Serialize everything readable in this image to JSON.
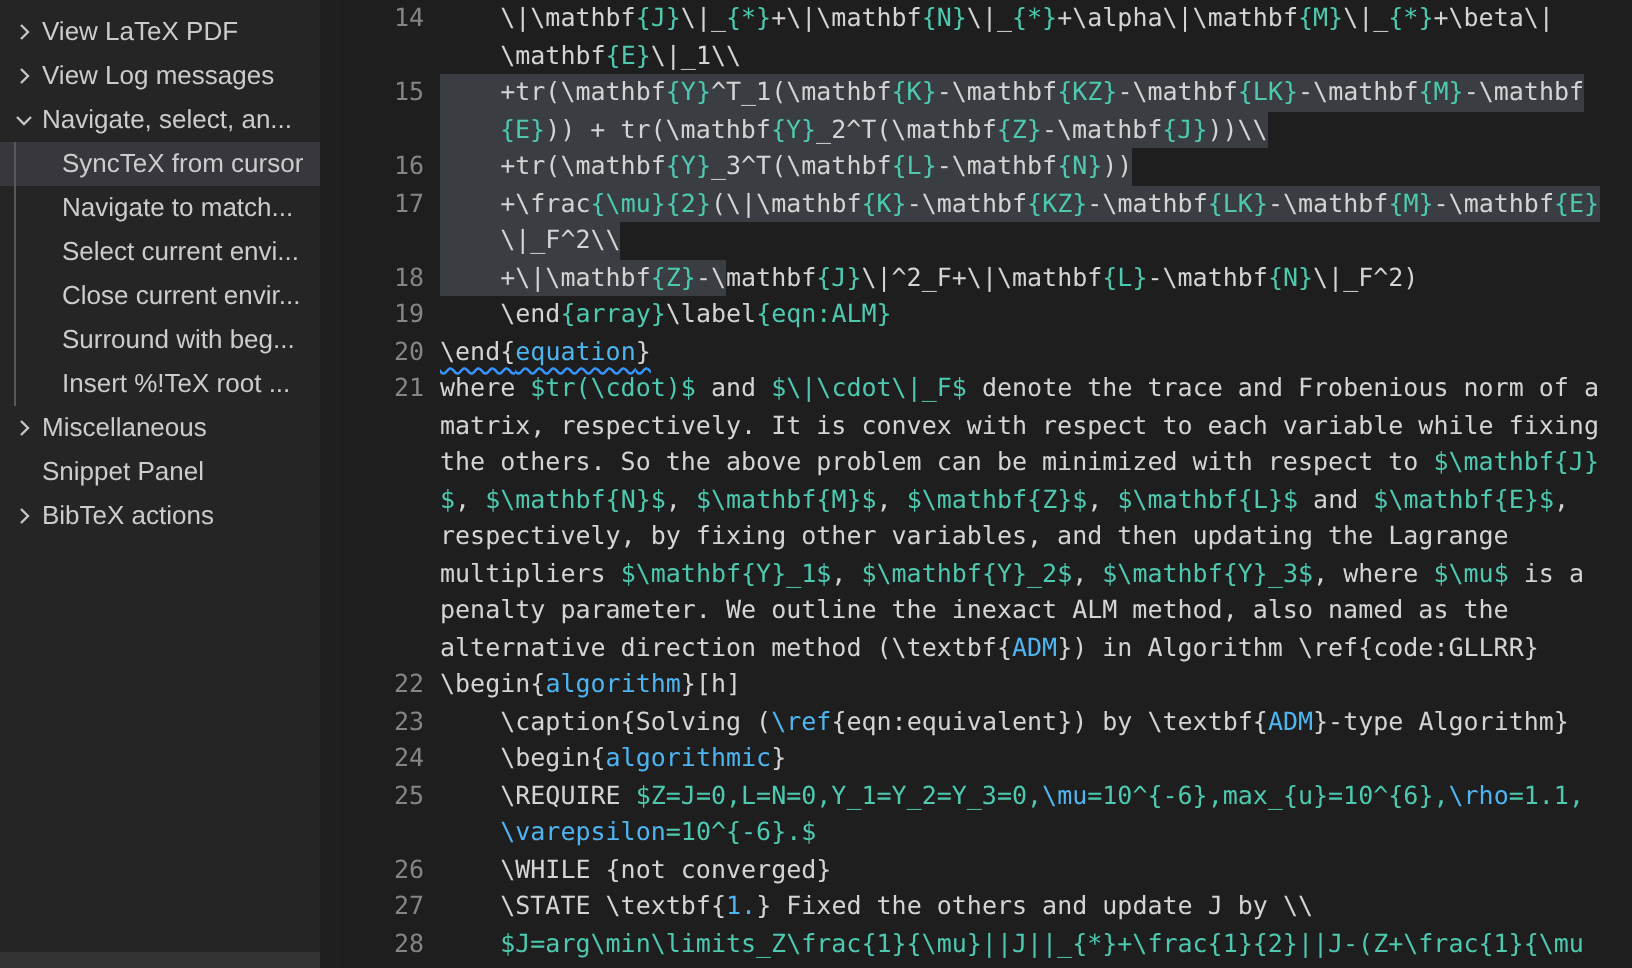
{
  "sidebar": {
    "items": [
      {
        "label": "View LaTeX PDF",
        "expanded": false,
        "selected": false
      },
      {
        "label": "View Log messages",
        "expanded": false,
        "selected": false
      },
      {
        "label": "Navigate, select, an...",
        "expanded": true,
        "selected": false,
        "children": [
          {
            "label": "SyncTeX from cursor",
            "selected": true
          },
          {
            "label": "Navigate to match...",
            "selected": false
          },
          {
            "label": "Select current envi...",
            "selected": false
          },
          {
            "label": "Close current envir...",
            "selected": false
          },
          {
            "label": "Surround with beg...",
            "selected": false
          },
          {
            "label": "Insert %!TeX root ...",
            "selected": false
          }
        ]
      },
      {
        "label": "Miscellaneous",
        "expanded": false,
        "selected": false
      },
      {
        "label": "Snippet Panel",
        "selected": false
      },
      {
        "label": "BibTeX actions",
        "expanded": false,
        "selected": false
      }
    ]
  },
  "editor": {
    "rows": [
      {
        "num": "14",
        "tokens": [
          {
            "kind": "plain",
            "text": "    \\|\\mathbf"
          },
          {
            "kind": "math",
            "text": "{J}"
          },
          {
            "kind": "plain",
            "text": "\\|_"
          },
          {
            "kind": "math",
            "text": "{*}"
          },
          {
            "kind": "plain",
            "text": "+\\|\\mathbf"
          },
          {
            "kind": "math",
            "text": "{N}"
          },
          {
            "kind": "plain",
            "text": "\\|_"
          },
          {
            "kind": "math",
            "text": "{*}"
          },
          {
            "kind": "plain",
            "text": "+\\alpha\\|\\mathbf"
          },
          {
            "kind": "math",
            "text": "{M}"
          },
          {
            "kind": "plain",
            "text": "\\|_"
          },
          {
            "kind": "math",
            "text": "{*}"
          },
          {
            "kind": "plain",
            "text": "+\\beta\\|"
          }
        ]
      },
      {
        "tokens": [
          {
            "kind": "plain",
            "text": "    \\mathbf"
          },
          {
            "kind": "math",
            "text": "{E}"
          },
          {
            "kind": "plain",
            "text": "\\|_1\\\\"
          }
        ]
      },
      {
        "num": "15",
        "tokens": [
          {
            "kind": "plain",
            "text": "    +tr(\\mathbf",
            "selected": true
          },
          {
            "kind": "math",
            "text": "{Y}",
            "selected": true
          },
          {
            "kind": "plain",
            "text": "^T_1(\\mathbf",
            "selected": true
          },
          {
            "kind": "math",
            "text": "{K}",
            "selected": true
          },
          {
            "kind": "plain",
            "text": "-\\mathbf",
            "selected": true
          },
          {
            "kind": "math",
            "text": "{KZ}",
            "selected": true
          },
          {
            "kind": "plain",
            "text": "-\\mathbf",
            "selected": true
          },
          {
            "kind": "math",
            "text": "{LK}",
            "selected": true
          },
          {
            "kind": "plain",
            "text": "-\\mathbf",
            "selected": true
          },
          {
            "kind": "math",
            "text": "{M}",
            "selected": true
          },
          {
            "kind": "plain",
            "text": "-\\mathbf",
            "selected": true
          }
        ]
      },
      {
        "indented": true,
        "tokens": [
          {
            "kind": "math",
            "text": "{E}",
            "selected": true
          },
          {
            "kind": "plain",
            "text": ")) + tr(\\mathbf",
            "selected": true
          },
          {
            "kind": "math",
            "text": "{Y}",
            "selected": true
          },
          {
            "kind": "plain",
            "text": "_2^T(\\mathbf",
            "selected": true
          },
          {
            "kind": "math",
            "text": "{Z}",
            "selected": true
          },
          {
            "kind": "plain",
            "text": "-\\mathbf",
            "selected": true
          },
          {
            "kind": "math",
            "text": "{J}",
            "selected": true
          },
          {
            "kind": "plain",
            "text": "))\\\\",
            "selected": true
          }
        ]
      },
      {
        "num": "16",
        "tokens": [
          {
            "kind": "plain",
            "text": "    +tr(\\mathbf",
            "selected": true
          },
          {
            "kind": "math",
            "text": "{Y}",
            "selected": true
          },
          {
            "kind": "plain",
            "text": "_3^T(\\mathbf",
            "selected": true
          },
          {
            "kind": "math",
            "text": "{L}",
            "selected": true
          },
          {
            "kind": "plain",
            "text": "-\\mathbf",
            "selected": true
          },
          {
            "kind": "math",
            "text": "{N}",
            "selected": true
          },
          {
            "kind": "plain",
            "text": "))",
            "selected": true
          }
        ]
      },
      {
        "num": "17",
        "tokens": [
          {
            "kind": "plain",
            "text": "    +\\frac",
            "selected": true
          },
          {
            "kind": "math",
            "text": "{\\mu}{2}",
            "selected": true
          },
          {
            "kind": "plain",
            "text": "(\\|\\mathbf",
            "selected": true
          },
          {
            "kind": "math",
            "text": "{K}",
            "selected": true
          },
          {
            "kind": "plain",
            "text": "-\\mathbf",
            "selected": true
          },
          {
            "kind": "math",
            "text": "{KZ}",
            "selected": true
          },
          {
            "kind": "plain",
            "text": "-\\mathbf",
            "selected": true
          },
          {
            "kind": "math",
            "text": "{LK}",
            "selected": true
          },
          {
            "kind": "plain",
            "text": "-\\mathbf",
            "selected": true
          },
          {
            "kind": "math",
            "text": "{M}",
            "selected": true
          },
          {
            "kind": "plain",
            "text": "-\\mathbf",
            "selected": true
          },
          {
            "kind": "math",
            "text": "{E}",
            "selected": true
          }
        ]
      },
      {
        "tokens": [
          {
            "kind": "plain",
            "text": "    \\|_F^2\\\\",
            "selected": true
          }
        ]
      },
      {
        "num": "18",
        "tokens": [
          {
            "kind": "plain",
            "text": "    +\\|\\mathbf",
            "selected": true
          },
          {
            "kind": "math",
            "text": "{Z}",
            "selected": true
          },
          {
            "kind": "plain",
            "text": "-\\",
            "selected": true
          },
          {
            "kind": "plain",
            "text": "mathbf",
            "selected": false
          },
          {
            "kind": "math",
            "text": "{J}"
          },
          {
            "kind": "plain",
            "text": "\\|^2_F+\\|\\mathbf"
          },
          {
            "kind": "math",
            "text": "{L}"
          },
          {
            "kind": "plain",
            "text": "-\\mathbf"
          },
          {
            "kind": "math",
            "text": "{N}"
          },
          {
            "kind": "plain",
            "text": "\\|_F^2)"
          }
        ]
      },
      {
        "num": "19",
        "tokens": [
          {
            "kind": "plain",
            "text": "    \\end"
          },
          {
            "kind": "math",
            "text": "{array}"
          },
          {
            "kind": "plain",
            "text": "\\label"
          },
          {
            "kind": "math",
            "text": "{eqn:ALM}"
          }
        ]
      },
      {
        "num": "20",
        "warning": true,
        "tokens": [
          {
            "kind": "plain",
            "text": "\\end{"
          },
          {
            "kind": "name",
            "text": "equation"
          },
          {
            "kind": "plain",
            "text": "}"
          }
        ]
      },
      {
        "num": "21",
        "tokens": [
          {
            "kind": "plain",
            "text": "where "
          },
          {
            "kind": "math",
            "text": "$tr(\\cdot)$"
          },
          {
            "kind": "plain",
            "text": " and "
          },
          {
            "kind": "math",
            "text": "$\\|\\cdot\\|_F$"
          },
          {
            "kind": "plain",
            "text": " denote the trace and Frobenious norm of a"
          }
        ]
      },
      {
        "tokens": [
          {
            "kind": "plain",
            "text": "matrix, respectively. It is convex with respect to each variable while fixing"
          }
        ]
      },
      {
        "tokens": [
          {
            "kind": "plain",
            "text": "the others. So the above problem can be minimized with respect to "
          },
          {
            "kind": "math",
            "text": "$\\mathbf{J}"
          }
        ]
      },
      {
        "tokens": [
          {
            "kind": "math",
            "text": "$"
          },
          {
            "kind": "plain",
            "text": ", "
          },
          {
            "kind": "math",
            "text": "$\\mathbf{N}$"
          },
          {
            "kind": "plain",
            "text": ", "
          },
          {
            "kind": "math",
            "text": "$\\mathbf{M}$"
          },
          {
            "kind": "plain",
            "text": ", "
          },
          {
            "kind": "math",
            "text": "$\\mathbf{Z}$"
          },
          {
            "kind": "plain",
            "text": ", "
          },
          {
            "kind": "math",
            "text": "$\\mathbf{L}$"
          },
          {
            "kind": "plain",
            "text": " and "
          },
          {
            "kind": "math",
            "text": "$\\mathbf{E}$"
          },
          {
            "kind": "plain",
            "text": ","
          }
        ]
      },
      {
        "tokens": [
          {
            "kind": "plain",
            "text": "respectively, by fixing other variables, and then updating the Lagrange"
          }
        ]
      },
      {
        "tokens": [
          {
            "kind": "plain",
            "text": "multipliers "
          },
          {
            "kind": "math",
            "text": "$\\mathbf{Y}_1$"
          },
          {
            "kind": "plain",
            "text": ", "
          },
          {
            "kind": "math",
            "text": "$\\mathbf{Y}_2$"
          },
          {
            "kind": "plain",
            "text": ", "
          },
          {
            "kind": "math",
            "text": "$\\mathbf{Y}_3$"
          },
          {
            "kind": "plain",
            "text": ", where "
          },
          {
            "kind": "math",
            "text": "$\\mu$"
          },
          {
            "kind": "plain",
            "text": " is a"
          }
        ]
      },
      {
        "tokens": [
          {
            "kind": "plain",
            "text": "penalty parameter. We outline the inexact ALM method, also named as the"
          }
        ]
      },
      {
        "tokens": [
          {
            "kind": "plain",
            "text": "alternative direction method (\\textbf{"
          },
          {
            "kind": "name",
            "text": "ADM"
          },
          {
            "kind": "plain",
            "text": "}) in Algorithm \\ref{code:GLLRR}"
          }
        ]
      },
      {
        "num": "22",
        "tokens": [
          {
            "kind": "plain",
            "text": "\\begin{"
          },
          {
            "kind": "name",
            "text": "algorithm"
          },
          {
            "kind": "plain",
            "text": "}[h]"
          }
        ]
      },
      {
        "num": "23",
        "tokens": [
          {
            "kind": "plain",
            "text": "    \\caption{Solving ("
          },
          {
            "kind": "name",
            "text": "\\ref"
          },
          {
            "kind": "plain",
            "text": "{eqn:equivalent}) by \\textbf{"
          },
          {
            "kind": "name",
            "text": "ADM"
          },
          {
            "kind": "plain",
            "text": "}-type Algorithm}"
          }
        ]
      },
      {
        "num": "24",
        "tokens": [
          {
            "kind": "plain",
            "text": "    \\begin{"
          },
          {
            "kind": "name",
            "text": "algorithmic"
          },
          {
            "kind": "plain",
            "text": "}"
          }
        ]
      },
      {
        "num": "25",
        "tokens": [
          {
            "kind": "plain",
            "text": "    \\REQUIRE "
          },
          {
            "kind": "math",
            "text": "$Z=J=0,L=N=0,Y_1=Y_2=Y_3=0,"
          },
          {
            "kind": "name",
            "text": "\\mu"
          },
          {
            "kind": "math",
            "text": "=10^{-6},max_{u}=10^{6},"
          },
          {
            "kind": "name",
            "text": "\\rho"
          },
          {
            "kind": "math",
            "text": "=1.1,"
          }
        ]
      },
      {
        "indented": true,
        "tokens": [
          {
            "kind": "name",
            "text": "\\varepsilon"
          },
          {
            "kind": "math",
            "text": "=10^{-6}.$"
          }
        ]
      },
      {
        "num": "26",
        "tokens": [
          {
            "kind": "plain",
            "text": "    \\WHILE {not converged}"
          }
        ]
      },
      {
        "num": "27",
        "tokens": [
          {
            "kind": "plain",
            "text": "    \\STATE \\textbf{"
          },
          {
            "kind": "name",
            "text": "1."
          },
          {
            "kind": "plain",
            "text": "} Fixed the others and update J by \\\\"
          }
        ]
      },
      {
        "num": "28",
        "indented": true,
        "tokens": [
          {
            "kind": "math",
            "text": "$J=arg\\min\\limits_Z\\frac{1}{\\mu}||J||_{*}+\\frac{1}{2}||J-(Z+\\frac{1}{\\mu"
          }
        ]
      }
    ]
  }
}
